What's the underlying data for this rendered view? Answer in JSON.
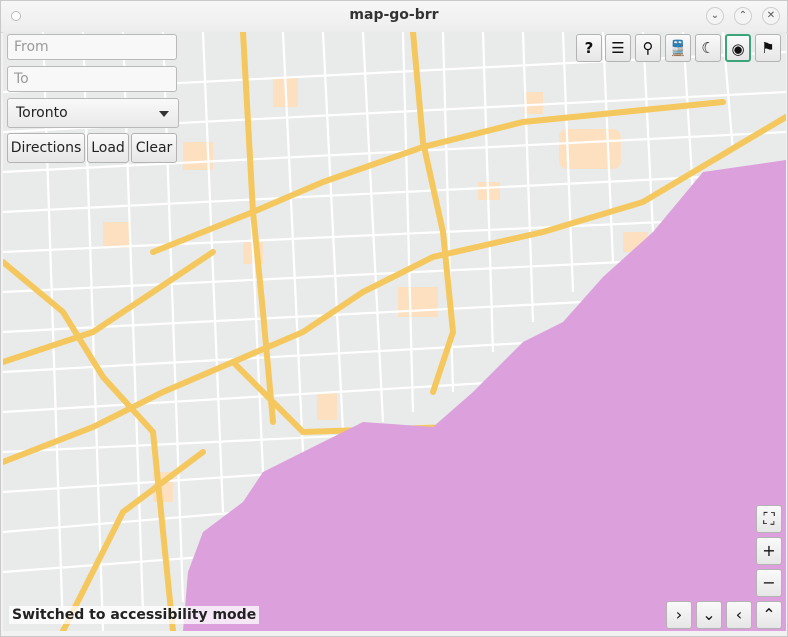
{
  "window": {
    "title": "map-go-brr"
  },
  "route": {
    "from_placeholder": "From",
    "to_placeholder": "To",
    "city": "Toronto",
    "directions_label": "Directions",
    "load_label": "Load",
    "clear_label": "Clear"
  },
  "toolbar": {
    "help": "?",
    "list": "☰",
    "pin": "⚲",
    "transit": "🚆",
    "theme": "☾",
    "accessibility": "◉",
    "route": "⚑"
  },
  "map_controls": {
    "fullscreen": "⛶",
    "zoom_in": "+",
    "zoom_out": "−",
    "pan_right": "›",
    "pan_down": "⌄",
    "pan_left": "‹",
    "pan_up": "⌃"
  },
  "status": "Switched to accessibility mode",
  "colors": {
    "water": "#dca0dc",
    "land": "#e9ebea",
    "highway": "#f4c85e",
    "street": "#ffffff",
    "park": "#fde0c0",
    "accent": "#3aa57a"
  }
}
